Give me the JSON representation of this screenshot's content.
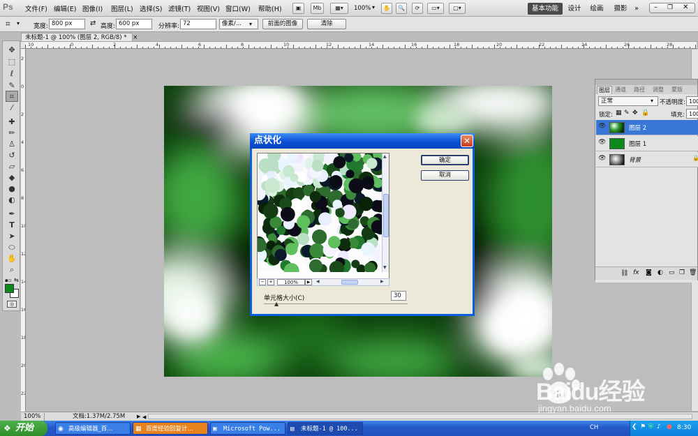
{
  "app": {
    "logo": "Ps"
  },
  "menu": [
    "文件(F)",
    "编辑(E)",
    "图像(I)",
    "图层(L)",
    "选择(S)",
    "滤镜(T)",
    "视图(V)",
    "窗口(W)",
    "帮助(H)"
  ],
  "menubar_controls": {
    "mb_label": "Mb",
    "zoom": "100%"
  },
  "workspaces": [
    "基本功能",
    "设计",
    "绘画",
    "摄影",
    "»"
  ],
  "options": {
    "width_label": "宽度:",
    "width_value": "800 px",
    "height_label": "高度:",
    "height_value": "600 px",
    "resolution_label": "分辨率:",
    "resolution_value": "72",
    "unit_value": "像素/...",
    "front_image_button": "前面的图像",
    "clear_button": "清除"
  },
  "document": {
    "tab_title": "未标题-1 @ 100% (图层 2, RGB/8) *",
    "close_glyph": "×"
  },
  "ruler_top_labels": [
    "10",
    "0",
    "2",
    "4",
    "6",
    "8",
    "10",
    "12",
    "14",
    "16",
    "18",
    "20",
    "22",
    "24",
    "26",
    "28"
  ],
  "ruler_left_labels": [
    "2",
    "0",
    "2",
    "4",
    "6",
    "8",
    "10",
    "12",
    "14",
    "16",
    "18",
    "20",
    "22"
  ],
  "status": {
    "zoom": "100%",
    "doc_info": "文档:1.37M/2.75M"
  },
  "layers_panel": {
    "tabs": [
      "图层",
      "通道",
      "路径",
      "调整",
      "蒙版"
    ],
    "blend_mode": "正常",
    "opacity_label": "不透明度:",
    "opacity_value": "100%",
    "lock_label": "锁定:",
    "fill_label": "填充:",
    "fill_value": "100%",
    "layers": [
      {
        "name": "图层 2",
        "selected": true
      },
      {
        "name": "图层 1",
        "selected": false
      },
      {
        "name": "背景",
        "selected": false
      }
    ],
    "footer_icons": [
      "link-icon",
      "fx-icon",
      "mask-icon",
      "adjustment-icon",
      "folder-icon",
      "new-layer-icon",
      "trash-icon"
    ]
  },
  "dialog": {
    "title": "点状化",
    "ok_button": "确定",
    "cancel_button": "取消",
    "preview_zoom": "100%",
    "cell_size_label": "单元格大小(C)",
    "cell_size_value": "30"
  },
  "taskbar": {
    "start": "开始",
    "tasks": [
      "高级编辑器_百...",
      "百度经验回复计...",
      "Microsoft Pow...",
      "未标题-1 @ 100..."
    ],
    "lang": "CH",
    "time": "8:30"
  },
  "watermark": {
    "brand": "Baidu经验",
    "url": "jingyan.baidu.com"
  },
  "colors": {
    "foreground": "#0a8a1a",
    "background": "#ffffff",
    "dialog_titlebar": "#0a4fd6",
    "selected_layer": "#3877d6"
  }
}
